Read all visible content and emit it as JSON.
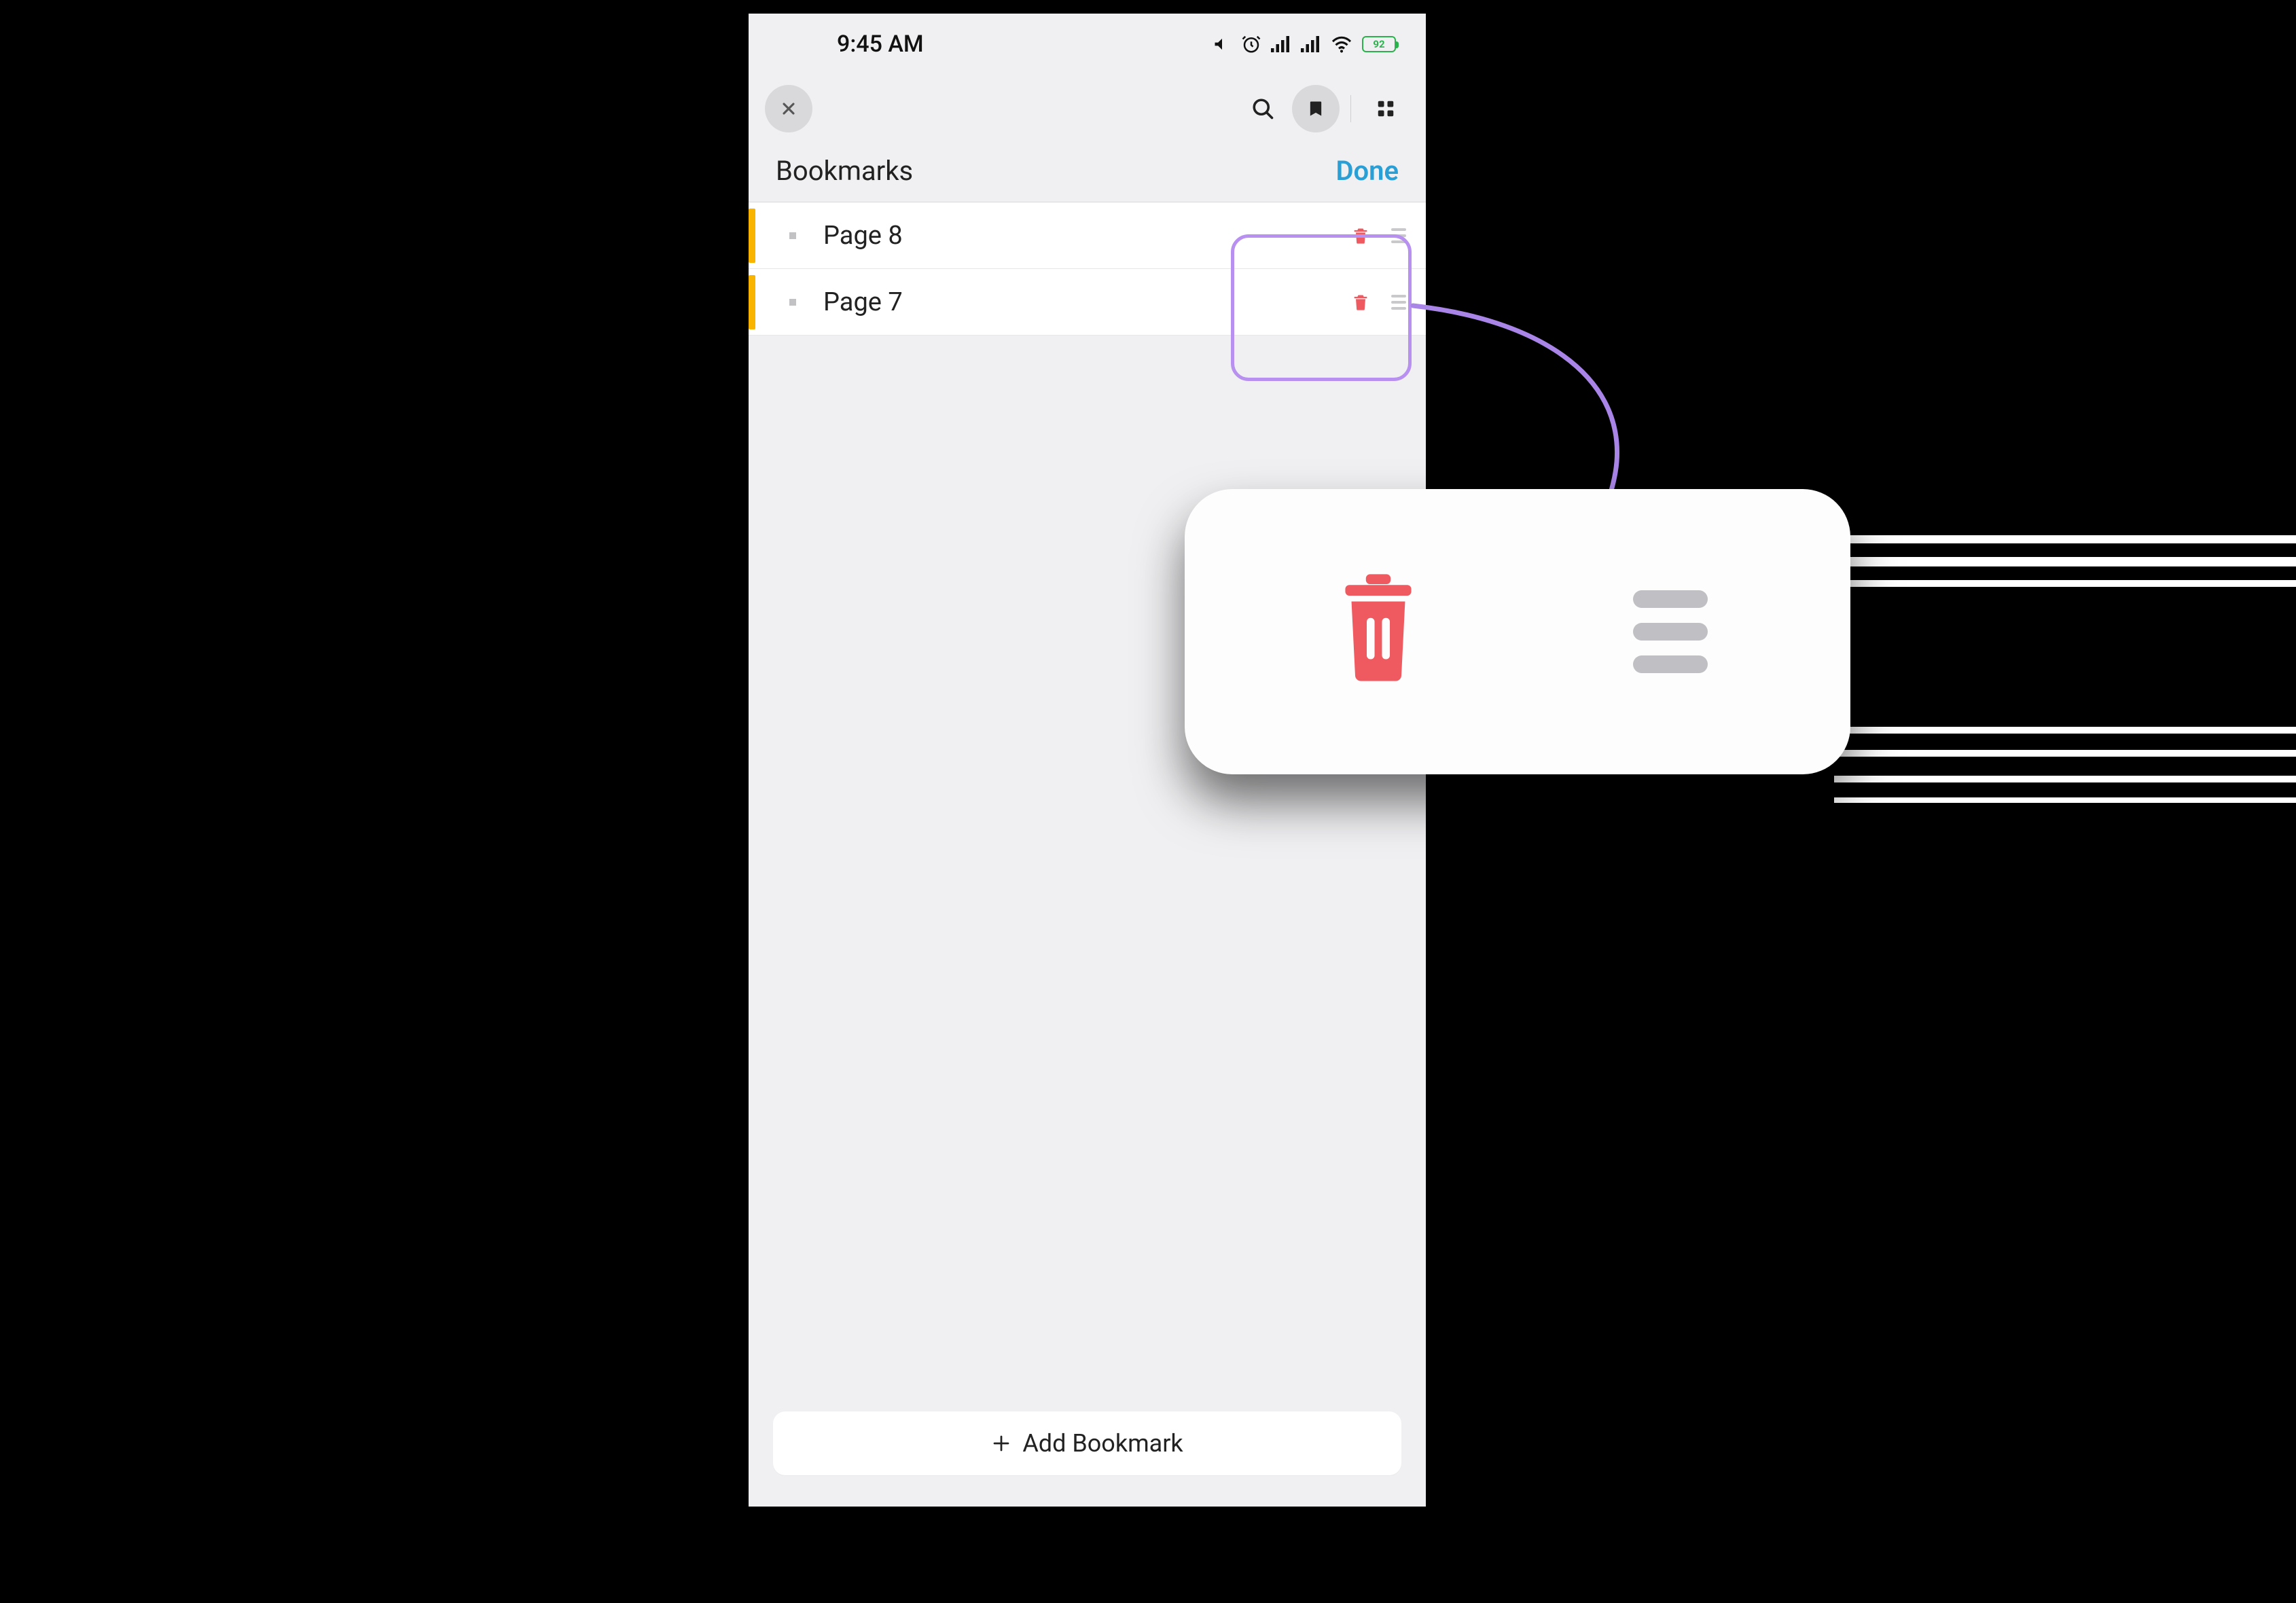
{
  "status": {
    "time": "9:45 AM",
    "battery": "92"
  },
  "header": {
    "title": "Bookmarks",
    "done": "Done"
  },
  "bookmarks": [
    {
      "label": "Page 8"
    },
    {
      "label": "Page 7"
    }
  ],
  "footer": {
    "add_label": "Add Bookmark"
  },
  "callout": {
    "delete_semantic": "delete",
    "reorder_semantic": "reorder"
  }
}
